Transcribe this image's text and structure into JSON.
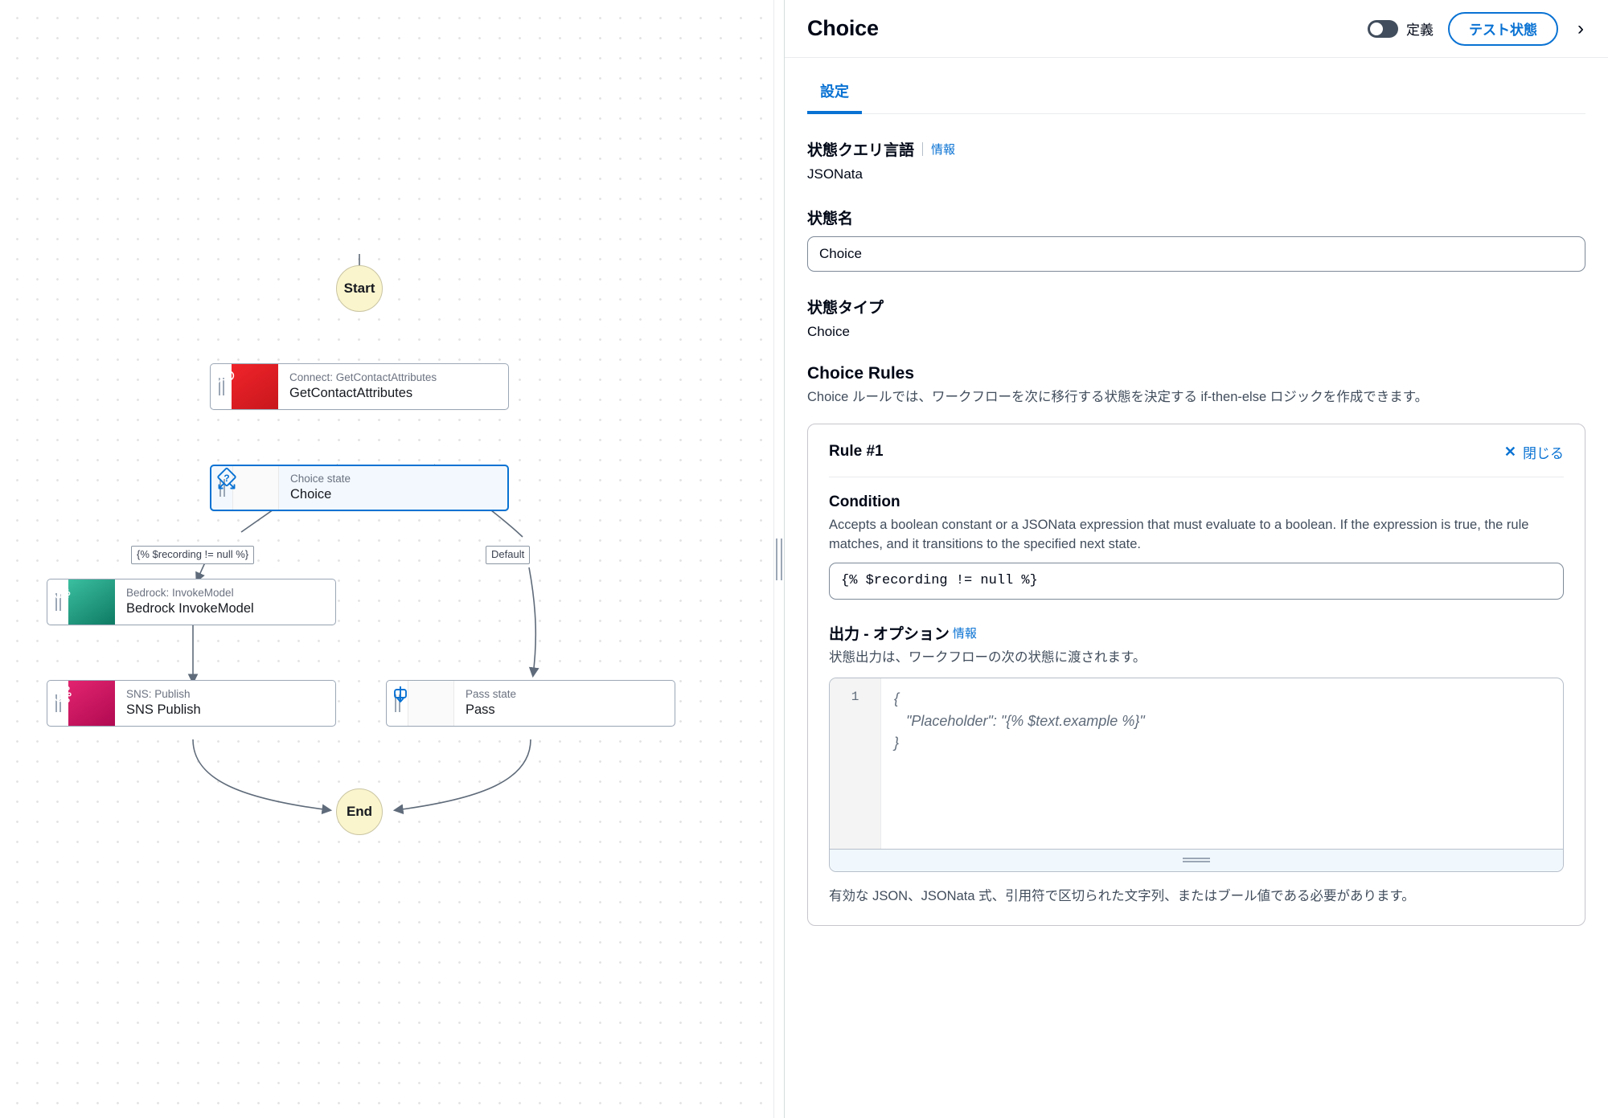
{
  "canvas": {
    "nodes": [
      {
        "id": "start",
        "label": "Start",
        "type": "terminal"
      },
      {
        "id": "getcontactattributes",
        "subtitle": "Connect: GetContactAttributes",
        "title": "GetContactAttributes",
        "icon": "amazon-connect-icon",
        "color": "#ed1c24"
      },
      {
        "id": "choice",
        "subtitle": "Choice state",
        "title": "Choice",
        "icon": "choice-state-icon",
        "color": "#0972d3",
        "selected": true
      },
      {
        "id": "bedrock",
        "subtitle": "Bedrock: InvokeModel",
        "title": "Bedrock InvokeModel",
        "icon": "amazon-bedrock-icon",
        "color": "#0e7a64"
      },
      {
        "id": "sns",
        "subtitle": "SNS: Publish",
        "title": "SNS Publish",
        "icon": "amazon-sns-icon",
        "color": "#c9186a"
      },
      {
        "id": "pass",
        "subtitle": "Pass state",
        "title": "Pass",
        "icon": "pass-state-icon",
        "color": "#0972d3"
      },
      {
        "id": "end",
        "label": "End",
        "type": "terminal"
      }
    ],
    "edge_labels": [
      {
        "id": "edge-condition",
        "text": "{% $recording != null %}"
      },
      {
        "id": "edge-default",
        "text": "Default"
      }
    ]
  },
  "panel": {
    "header": {
      "title": "Choice",
      "toggle_label": "定義",
      "test_button": "テスト状態",
      "collapse_icon": "chevron-right-icon"
    },
    "tabs": [
      {
        "id": "settings",
        "label": "設定",
        "active": true
      }
    ],
    "query_language": {
      "label": "状態クエリ言語",
      "info": "情報",
      "value": "JSONata"
    },
    "state_name": {
      "label": "状態名",
      "value": "Choice"
    },
    "state_type": {
      "label": "状態タイプ",
      "value": "Choice"
    },
    "choice_rules": {
      "heading": "Choice Rules",
      "description": "Choice ルールでは、ワークフローを次に移行する状態を決定する if-then-else ロジックを作成できます。",
      "rule": {
        "title": "Rule #1",
        "close_label": "閉じる",
        "close_icon": "close-x-icon",
        "condition": {
          "label": "Condition",
          "description": "Accepts a boolean constant or a JSONata expression that must evaluate to a boolean. If the expression is true, the rule matches, and it transitions to the specified next state.",
          "value": "{% $recording != null %}"
        },
        "output": {
          "label": "出力 - オプション",
          "info": "情報",
          "description": "状態出力は、ワークフローの次の状態に渡されます。",
          "line_number": "1",
          "placeholder_code": "{\n   \"Placeholder\": \"{% $text.example %}\"\n}",
          "hint": "有効な JSON、JSONata 式、引用符で区切られた文字列、またはブール値である必要があります。"
        }
      }
    }
  },
  "colors": {
    "accent": "#0972d3",
    "selected_node_fill": "#f2f8fd",
    "terminal_fill": "#fbf5cd"
  }
}
